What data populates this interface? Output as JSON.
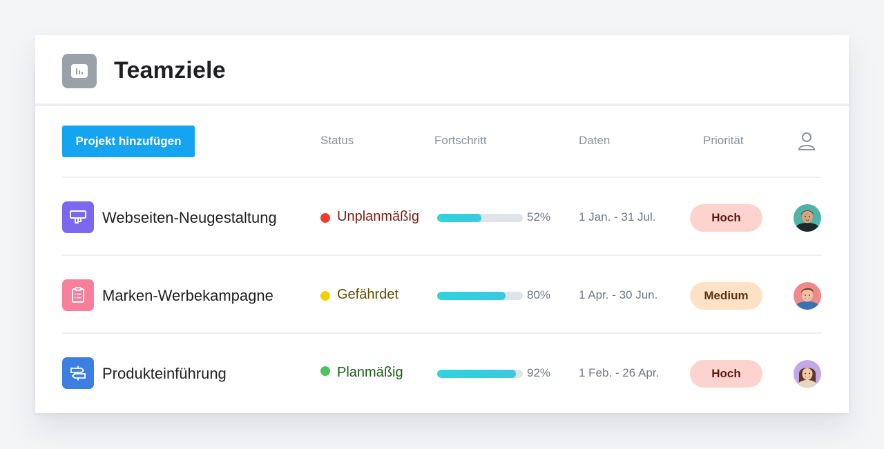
{
  "header": {
    "title": "Teamziele",
    "icon": "chart-icon"
  },
  "toolbar": {
    "add_project_label": "Projekt hinzufügen"
  },
  "columns": {
    "status": "Status",
    "progress": "Fortschritt",
    "dates": "Daten",
    "priority": "Priorität",
    "assignee_icon": "user-icon"
  },
  "colors": {
    "accent": "#14a4f0",
    "status_red": "#f23d2e",
    "status_yellow": "#f5d000",
    "status_green": "#4cc45a",
    "progress": "#2dd4de"
  },
  "projects": [
    {
      "name": "Webseiten-Neugestaltung",
      "icon": "monitor-icon",
      "icon_color": "#7b68ee",
      "status": "Unplanmäßig",
      "status_color": "#f23d2e",
      "status_text_color": "#7a1f14",
      "progress": 52,
      "progress_label": "52%",
      "dates": "1 Jan. - 31 Jul.",
      "priority": "Hoch",
      "priority_bg": "#fdd3d0",
      "priority_color": "#5c1a14"
    },
    {
      "name": "Marken-Werbekampagne",
      "icon": "clipboard-icon",
      "icon_color": "#f77f9c",
      "status": "Gefährdet",
      "status_color": "#f5d000",
      "status_text_color": "#5e4e00",
      "progress": 80,
      "progress_label": "80%",
      "dates": "1 Apr. - 30 Jun.",
      "priority": "Medium",
      "priority_bg": "#fde2c6",
      "priority_color": "#5c3412"
    },
    {
      "name": "Produkteinführung",
      "icon": "signpost-icon",
      "icon_color": "#3c7fe0",
      "status": "Planmäßig",
      "status_color": "#4cc45a",
      "status_text_color": "#1b5e12",
      "progress": 92,
      "progress_label": "92%",
      "dates": "1 Feb. - 26 Apr.",
      "priority": "Hoch",
      "priority_bg": "#fdd3d0",
      "priority_color": "#5c1a14"
    }
  ]
}
